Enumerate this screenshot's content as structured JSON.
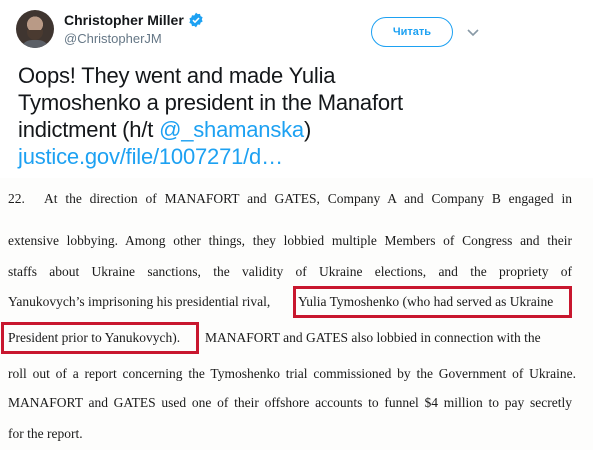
{
  "author": {
    "display_name": "Christopher Miller",
    "handle": "@ChristopherJM"
  },
  "follow_button": {
    "label": "Читать"
  },
  "tweet": {
    "text_part1": "Oops! They went and made Yulia Tymoshenko a president in the Manafort indictment (h/t ",
    "mention": "@_shamanska",
    "text_part2": ")",
    "link": "justice.gov/file/1007271/d…"
  },
  "document": {
    "paragraph_number": "22.",
    "lines": [
      "At the direction of MANAFORT and GATES, Company A and Company B engaged in",
      "extensive lobbying.   Among other things, they lobbied multiple Members of Congress and their",
      "staffs about Ukraine sanctions, the validity of Ukraine elections, and the propriety of",
      "Yanukovych’s imprisoning his presidential rival,",
      "Yulia Tymoshenko (who had served as Ukraine",
      "President prior to Yanukovych).",
      "MANAFORT and GATES also lobbied in connection with the",
      "roll out of a report concerning the Tymoshenko trial commissioned by the Government of Ukraine.",
      "MANAFORT and GATES used one of their offshore accounts to funnel $4 million to pay secretly",
      "for the report."
    ]
  },
  "colors": {
    "accent": "#1da1f2",
    "highlight": "#c8172e",
    "handle_gray": "#657786"
  },
  "icons": [
    "verified-badge-icon",
    "chevron-down-icon"
  ]
}
